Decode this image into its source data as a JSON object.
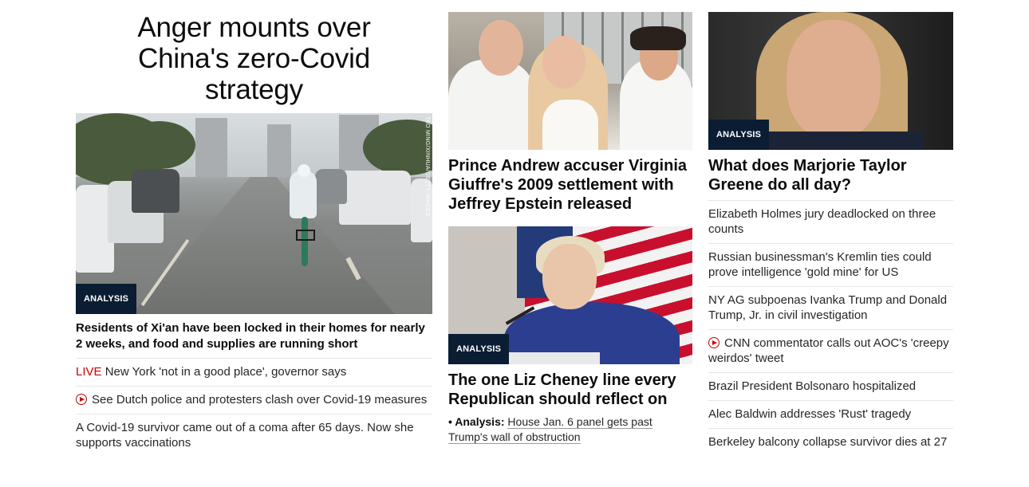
{
  "left": {
    "hero_title": "Anger mounts over China's zero-Covid strategy",
    "image_credit": "TAO MING/XINHUA/GETTY IMAGES",
    "tag": "ANALYSIS",
    "lead_headline": "Residents of Xi'an have been locked in their homes for nearly 2 weeks, and food and supplies are running short",
    "items": [
      {
        "live_label": "LIVE",
        "text": " New York 'not in a good place', governor says"
      },
      {
        "text": "See Dutch police and protesters clash over Covid-19 measures",
        "video": true
      },
      {
        "text": "A Covid-19 survivor came out of a coma after 65 days. Now she supports vaccinations"
      }
    ]
  },
  "middle": {
    "story1": {
      "headline": "Prince Andrew accuser Virginia Giuffre's 2009 settlement with Jeffrey Epstein released"
    },
    "story2": {
      "tag": "ANALYSIS",
      "headline": "The one Liz Cheney line every Republican should reflect on",
      "analysis_prefix": "• Analysis:",
      "analysis_text": "House Jan. 6 panel gets past Trump's wall of obstruction"
    }
  },
  "right": {
    "tag": "ANALYSIS",
    "headline": "What does Marjorie Taylor Greene do all day?",
    "items": [
      {
        "text": "Elizabeth Holmes jury deadlocked on three counts"
      },
      {
        "text": "Russian businessman's Kremlin ties could prove intelligence 'gold mine' for US"
      },
      {
        "text": "NY AG subpoenas Ivanka Trump and Donald Trump, Jr. in civil investigation"
      },
      {
        "text": "CNN commentator calls out AOC's 'creepy weirdos' tweet",
        "video": true
      },
      {
        "text": "Brazil President Bolsonaro hospitalized"
      },
      {
        "text": "Alec Baldwin addresses 'Rust' tragedy"
      },
      {
        "text": "Berkeley balcony collapse survivor dies at 27"
      }
    ]
  },
  "colors": {
    "accent_red": "#cc0000",
    "tag_bg": "#0a1d33",
    "text": "#0c0c0c"
  }
}
